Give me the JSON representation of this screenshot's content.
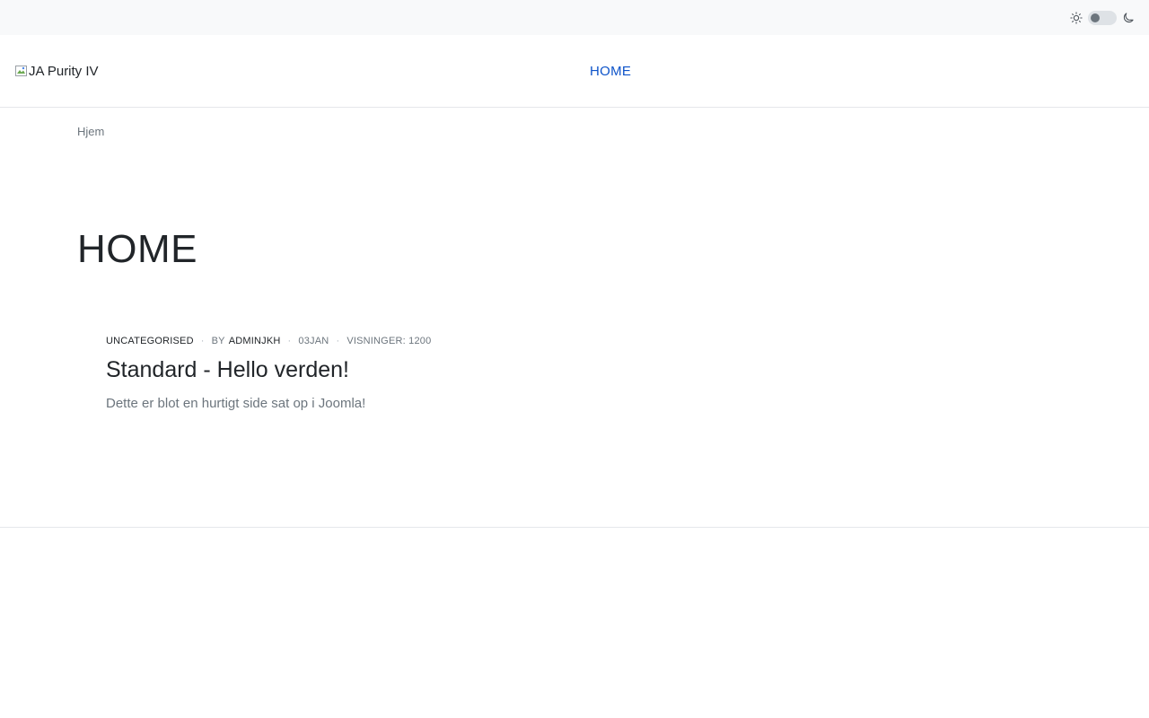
{
  "topbar": {
    "theme_light_icon": "sun-icon",
    "theme_dark_icon": "moon-icon"
  },
  "header": {
    "logo_alt": "JA Purity IV",
    "nav": [
      {
        "label": "HOME"
      }
    ],
    "nav_active_color": "#0d53c9"
  },
  "breadcrumb": {
    "item": "Hjem"
  },
  "page": {
    "title": "HOME"
  },
  "article": {
    "category": "UNCATEGORISED",
    "by_label": "BY",
    "author": "ADMINJKH",
    "date": "03JAN",
    "hits": "VISNINGER: 1200",
    "title": "Standard - Hello verden!",
    "intro": "Dette er blot en hurtigt side sat op i Joomla!"
  }
}
